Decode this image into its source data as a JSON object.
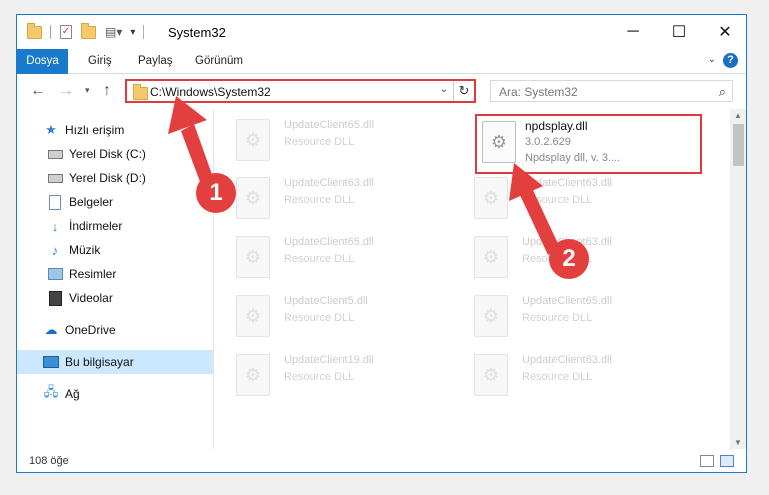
{
  "window": {
    "title": "System32",
    "minimize": "─",
    "maximize": "☐",
    "close": "✕"
  },
  "ribbon": {
    "tabs": [
      "Dosya",
      "Giriş",
      "Paylaş",
      "Görünüm"
    ],
    "help": "?"
  },
  "nav": {
    "back": "←",
    "forward": "→",
    "up": "↑",
    "address": "C:\\Windows\\System32",
    "search_placeholder": "Ara: System32"
  },
  "sidebar": {
    "items": [
      {
        "label": "Hızlı erişim",
        "icon": "star-icon",
        "pinned": false
      },
      {
        "label": "Yerel Disk (C:)",
        "icon": "drive-icon",
        "pinned": true
      },
      {
        "label": "Yerel Disk (D:)",
        "icon": "drive-icon",
        "pinned": true
      },
      {
        "label": "Belgeler",
        "icon": "documents-icon",
        "pinned": true
      },
      {
        "label": "İndirmeler",
        "icon": "download-icon",
        "pinned": true
      },
      {
        "label": "Müzik",
        "icon": "music-icon",
        "pinned": true
      },
      {
        "label": "Resimler",
        "icon": "pictures-icon",
        "pinned": true
      },
      {
        "label": "Videolar",
        "icon": "video-icon",
        "pinned": true
      },
      {
        "label": "OneDrive",
        "icon": "cloud-icon",
        "pinned": false
      },
      {
        "label": "Bu bilgisayar",
        "icon": "computer-icon",
        "pinned": false,
        "active": true
      },
      {
        "label": "Ağ",
        "icon": "network-icon",
        "pinned": false
      }
    ]
  },
  "files": [
    {
      "name": "UpdateClient65.dll",
      "desc": "Resource DLL"
    },
    {
      "name": "npdsplay.dll",
      "version": "3.0.2.629",
      "desc": "Npdsplay dll, v. 3....",
      "highlighted": true
    },
    {
      "name": "UpdateClient63.dll",
      "desc": "Resource DLL"
    },
    {
      "name": "UpdateClient63.dll",
      "desc": "Resource DLL"
    },
    {
      "name": "UpdateClient65.dll",
      "desc": "Resource DLL"
    },
    {
      "name": "UpdateClient63.dll",
      "desc": "Resource DLL"
    },
    {
      "name": "UpdateClient5.dll",
      "desc": "Resource DLL"
    },
    {
      "name": "UpdateClient65.dll",
      "desc": "Resource DLL"
    },
    {
      "name": "UpdateClient19.dll",
      "desc": "Resource DLL"
    },
    {
      "name": "UpdateClient63.dll",
      "desc": "Resource DLL"
    }
  ],
  "status": {
    "item_count": "108 öğe"
  },
  "annotations": {
    "step1": "1",
    "step2": "2",
    "color": "#e43f3f"
  }
}
